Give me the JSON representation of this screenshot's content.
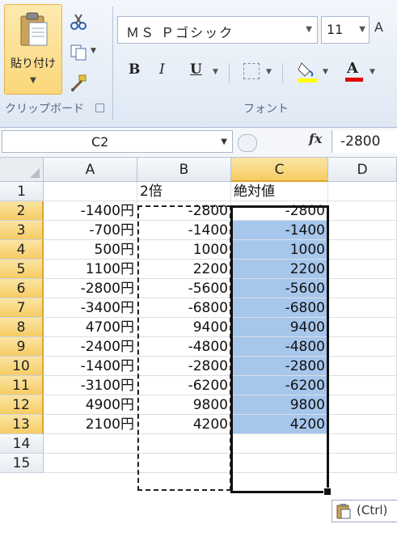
{
  "ribbon": {
    "clipboard": {
      "paste_label": "貼り付け",
      "group_label": "クリップボード"
    },
    "font": {
      "font_name": "ＭＳ Ｐゴシック",
      "font_size": "11",
      "bold_label": "B",
      "italic_label": "I",
      "underline_label": "U",
      "font_color_letter": "A",
      "group_label": "フォント",
      "font_color": "#e00000",
      "fill_color": "#ffff00"
    }
  },
  "formula_bar": {
    "name_box": "C2",
    "fx_label": "fx",
    "formula": "-2800"
  },
  "sheet": {
    "columns": [
      "A",
      "B",
      "C",
      "D"
    ],
    "rows": [
      "1",
      "2",
      "3",
      "4",
      "5",
      "6",
      "7",
      "8",
      "9",
      "10",
      "11",
      "12",
      "13",
      "14",
      "15"
    ],
    "header_row": [
      "",
      "2倍",
      "絶対値",
      ""
    ],
    "data": [
      [
        "-1400円",
        "-2800",
        "-2800"
      ],
      [
        "-700円",
        "-1400",
        "-1400"
      ],
      [
        "500円",
        "1000",
        "1000"
      ],
      [
        "1100円",
        "2200",
        "2200"
      ],
      [
        "-2800円",
        "-5600",
        "-5600"
      ],
      [
        "-3400円",
        "-6800",
        "-6800"
      ],
      [
        "4700円",
        "9400",
        "9400"
      ],
      [
        "-2400円",
        "-4800",
        "-4800"
      ],
      [
        "-1400円",
        "-2800",
        "-2800"
      ],
      [
        "-3100円",
        "-6200",
        "-6200"
      ],
      [
        "4900円",
        "9800",
        "9800"
      ],
      [
        "2100円",
        "4200",
        "4200"
      ]
    ],
    "selection_color": "#a7c6ec",
    "header_selected_color": "#f6cc63"
  },
  "paste_options": {
    "label": "(Ctrl)"
  }
}
